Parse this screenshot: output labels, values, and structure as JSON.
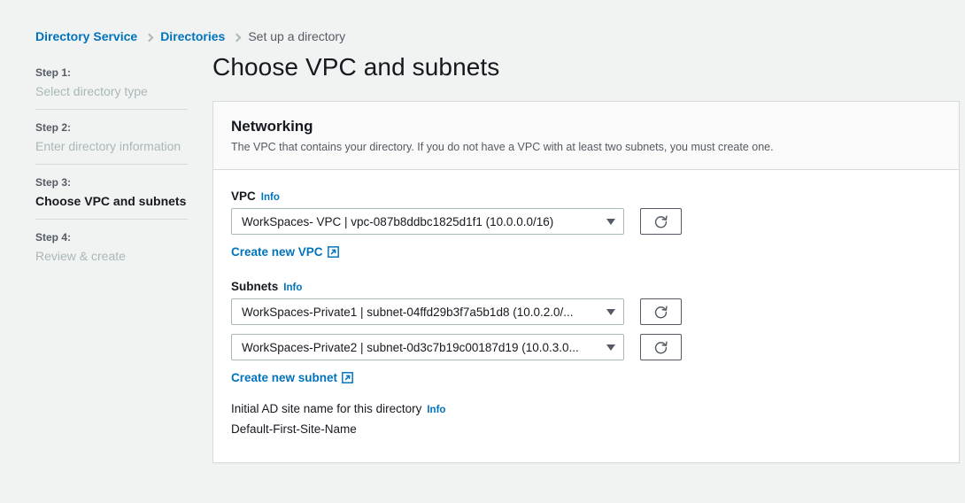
{
  "breadcrumb": {
    "items": [
      {
        "label": "Directory Service",
        "type": "link"
      },
      {
        "label": "Directories",
        "type": "link"
      },
      {
        "label": "Set up a directory",
        "type": "current"
      }
    ]
  },
  "sidebar": {
    "steps": [
      {
        "num": "Step 1:",
        "label": "Select directory type",
        "active": false
      },
      {
        "num": "Step 2:",
        "label": "Enter directory information",
        "active": false
      },
      {
        "num": "Step 3:",
        "label": "Choose VPC and subnets",
        "active": true
      },
      {
        "num": "Step 4:",
        "label": "Review & create",
        "active": false
      }
    ]
  },
  "page": {
    "title": "Choose VPC and subnets"
  },
  "card": {
    "title": "Networking",
    "description": "The VPC that contains your directory. If you do not have a VPC with at least two subnets, you must create one."
  },
  "vpc": {
    "label": "VPC",
    "info_label": "Info",
    "selected": "WorkSpaces- VPC | vpc-087b8ddbc1825d1f1 (10.0.0.0/16)",
    "refresh_icon": "refresh-icon",
    "create_link": "Create new VPC",
    "external_icon": "external-link-icon"
  },
  "subnets": {
    "label": "Subnets",
    "info_label": "Info",
    "selected": [
      "WorkSpaces-Private1 | subnet-04ffd29b3f7a5b1d8 (10.0.2.0/...",
      "WorkSpaces-Private2 | subnet-0d3c7b19c00187d19 (10.0.3.0..."
    ],
    "refresh_icon": "refresh-icon",
    "create_link": "Create new subnet",
    "external_icon": "external-link-icon"
  },
  "site_name": {
    "label": "Initial AD site name for this directory",
    "info_label": "Info",
    "value": "Default-First-Site-Name"
  },
  "colors": {
    "link": "#0073bb",
    "page_background": "#f1f3f3",
    "card_background": "#ffffff",
    "border": "#d5dbdb",
    "muted_text": "#545b64",
    "disabled_text": "#aab7b8"
  }
}
